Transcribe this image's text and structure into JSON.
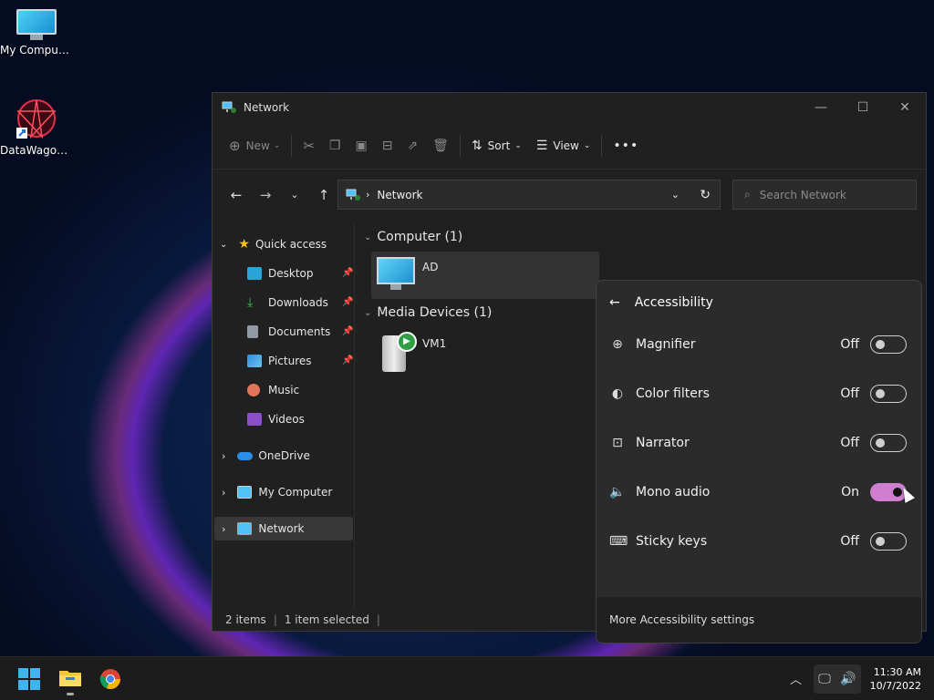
{
  "desktop": {
    "icons": [
      {
        "label": "My Computer",
        "icon": "monitor-icon"
      },
      {
        "label": "DataWagon...",
        "icon": "datawagon-shortcut-icon"
      }
    ]
  },
  "window": {
    "title": "Network",
    "toolbar": {
      "new_label": "New",
      "sort_label": "Sort",
      "view_label": "View",
      "more_label": "•••"
    },
    "address": {
      "path": "Network"
    },
    "search": {
      "placeholder": "Search Network"
    },
    "sidebar": {
      "quick_access": "Quick access",
      "items": [
        "Desktop",
        "Downloads",
        "Documents",
        "Pictures",
        "Music",
        "Videos"
      ],
      "onedrive": "OneDrive",
      "my_computer": "My Computer",
      "network": "Network"
    },
    "groups": [
      {
        "title": "Computer (1)",
        "item": "AD"
      },
      {
        "title": "Media Devices (1)",
        "item": "VM1"
      }
    ],
    "status": {
      "items": "2 items",
      "selected": "1 item selected"
    }
  },
  "accessibility": {
    "title": "Accessibility",
    "rows": [
      {
        "label": "Magnifier",
        "state": "Off",
        "icon": "magnifier-icon"
      },
      {
        "label": "Color filters",
        "state": "Off",
        "icon": "color-filters-icon"
      },
      {
        "label": "Narrator",
        "state": "Off",
        "icon": "narrator-icon"
      },
      {
        "label": "Mono audio",
        "state": "On",
        "icon": "mono-audio-icon"
      },
      {
        "label": "Sticky keys",
        "state": "Off",
        "icon": "sticky-keys-icon"
      }
    ],
    "footer": "More Accessibility settings",
    "accent": "#d07fd0"
  },
  "taskbar": {
    "time": "11:30 AM",
    "date": "10/7/2022"
  }
}
